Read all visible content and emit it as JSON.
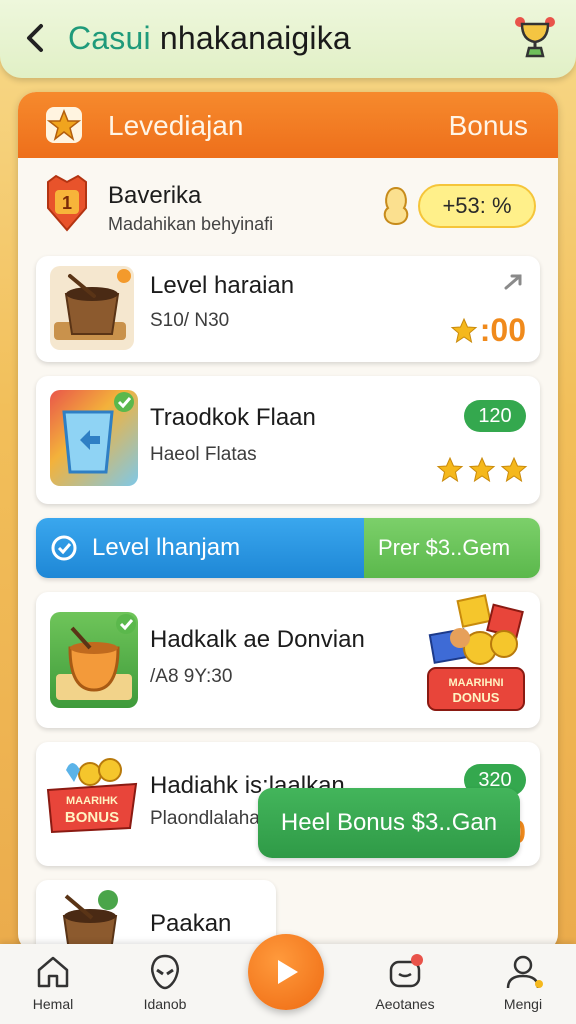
{
  "header": {
    "title_part1": "Casui",
    "title_part2": " nhakanaigika"
  },
  "panel": {
    "left_label": "Levediajan",
    "right_label": "Bonus"
  },
  "user": {
    "badge_number": "1",
    "name": "Baverika",
    "subtitle": "Madahikan behyinafi",
    "balance": "+53: %"
  },
  "cards": [
    {
      "title": "Level haraian",
      "subtitle": "S10/ N30",
      "score": ":00"
    },
    {
      "title": "Traodkok Flaan",
      "subtitle": "Haeol Flatas",
      "pill": "120"
    },
    {
      "title": "Hadkalk ae Donvian",
      "subtitle": "/A8 9Y:30",
      "promo_top": "MAARIHNI",
      "promo_bottom": "DONUS"
    },
    {
      "title": "Hadiahk is;laalkan",
      "subtitle": "Plaondlalahasi0i draian Haris",
      "pill": "320",
      "score": "00",
      "promo_top": "MAARIHK",
      "promo_bottom": "BONUS"
    },
    {
      "title": "Paakan"
    }
  ],
  "level_bar": {
    "left": "Level lhanjam",
    "right": "Prer $3..Gem"
  },
  "bonus_button": "Heel Bonus $3..Gan",
  "nav": [
    {
      "label": "Hemal"
    },
    {
      "label": "Idanob"
    },
    {
      "label": "Aeotanes"
    },
    {
      "label": "Mengi"
    }
  ],
  "colors": {
    "header_bg": "#e1f0c6",
    "panel_header": "#ee6f1b",
    "accent_green": "#34a84e",
    "accent_blue": "#1e87d6",
    "accent_orange": "#f08a1c"
  }
}
